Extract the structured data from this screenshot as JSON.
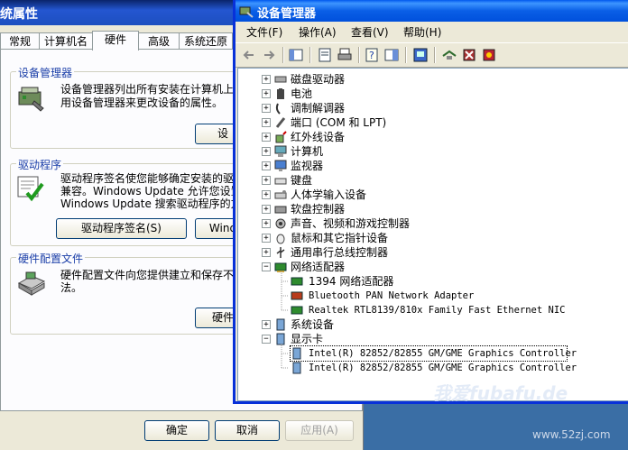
{
  "system_properties": {
    "title": "统属性",
    "tabs": [
      "常规",
      "计算机名",
      "硬件",
      "高级",
      "系统还原"
    ],
    "active_tab": "硬件",
    "device_manager_group": {
      "legend": "设备管理器",
      "text": [
        "设备管理器列出所有安装在计算机上",
        "用设备管理器来更改设备的属性。"
      ],
      "button": "设"
    },
    "driver_group": {
      "legend": "驱动程序",
      "text": [
        "驱动程序签名使您能够确定安装的驱",
        "兼容。Windows Update 允许您设置",
        "Windows Update 搜索驱动程序的方式"
      ],
      "buttons": [
        "驱动程序签名(S)",
        "Wind"
      ]
    },
    "hw_profile_group": {
      "legend": "硬件配置文件",
      "text": [
        "硬件配置文件向您提供建立和保存不",
        "法。"
      ],
      "button": "硬件"
    },
    "footer_buttons": [
      "确定",
      "取消",
      "应用(A)"
    ]
  },
  "device_manager": {
    "title": "设备管理器",
    "menus": [
      "文件(F)",
      "操作(A)",
      "查看(V)",
      "帮助(H)"
    ],
    "tree": [
      {
        "label": "磁盘驱动器",
        "icon": "disk-drive-icon",
        "state": "collapsed"
      },
      {
        "label": "电池",
        "icon": "battery-icon",
        "state": "collapsed"
      },
      {
        "label": "调制解调器",
        "icon": "modem-icon",
        "state": "collapsed"
      },
      {
        "label": "端口 (COM 和 LPT)",
        "icon": "port-icon",
        "state": "collapsed"
      },
      {
        "label": "红外线设备",
        "icon": "infrared-icon",
        "state": "collapsed"
      },
      {
        "label": "计算机",
        "icon": "computer-icon",
        "state": "collapsed"
      },
      {
        "label": "监视器",
        "icon": "monitor-icon",
        "state": "collapsed"
      },
      {
        "label": "键盘",
        "icon": "keyboard-icon",
        "state": "collapsed"
      },
      {
        "label": "人体学输入设备",
        "icon": "hid-icon",
        "state": "collapsed"
      },
      {
        "label": "软盘控制器",
        "icon": "floppy-controller-icon",
        "state": "collapsed"
      },
      {
        "label": "声音、视频和游戏控制器",
        "icon": "sound-icon",
        "state": "collapsed"
      },
      {
        "label": "鼠标和其它指针设备",
        "icon": "mouse-icon",
        "state": "collapsed"
      },
      {
        "label": "通用串行总线控制器",
        "icon": "usb-icon",
        "state": "collapsed"
      },
      {
        "label": "网络适配器",
        "icon": "network-adapter-icon",
        "state": "expanded",
        "children": [
          "1394 网络适配器",
          "Bluetooth PAN Network Adapter",
          "Realtek RTL8139/810x Family Fast Ethernet NIC"
        ]
      },
      {
        "label": "系统设备",
        "icon": "system-device-icon",
        "state": "collapsed"
      },
      {
        "label": "显示卡",
        "icon": "display-adapter-icon",
        "state": "expanded",
        "children": [
          "Intel(R) 82852/82855 GM/GME Graphics Controller",
          "Intel(R) 82852/82855 GM/GME Graphics Controller"
        ]
      }
    ],
    "selected_item": "Intel(R) 82852/82855 GM/GME Graphics Controller"
  },
  "watermark": {
    "text": "我爱fubafu.de",
    "site": "www.52zj.com"
  },
  "colors": {
    "titlebar_blue": "#0a5fe6",
    "dialog_bg": "#ece9d8",
    "group_legend": "#1a3ea8",
    "nic_green": "#2e8b2e"
  }
}
